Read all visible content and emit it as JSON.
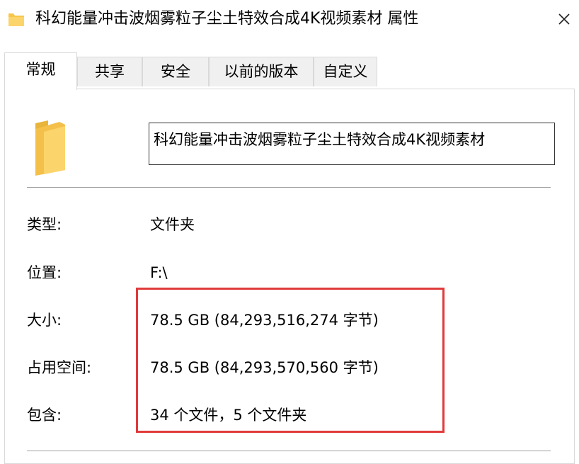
{
  "window": {
    "title": "科幻能量冲击波烟雾粒子尘土特效合成4K视频素材 属性",
    "icon": "folder-icon",
    "close_icon": "close-icon"
  },
  "tabs": [
    {
      "label": "常规",
      "active": true
    },
    {
      "label": "共享",
      "active": false
    },
    {
      "label": "安全",
      "active": false
    },
    {
      "label": "以前的版本",
      "active": false
    },
    {
      "label": "自定义",
      "active": false
    }
  ],
  "general": {
    "folder_name": "科幻能量冲击波烟雾粒子尘土特效合成4K视频素材",
    "properties": [
      {
        "label": "类型:",
        "value": "文件夹"
      },
      {
        "label": "位置:",
        "value": "F:\\"
      },
      {
        "label": "大小:",
        "value": "78.5 GB (84,293,516,274 字节)"
      },
      {
        "label": "占用空间:",
        "value": "78.5 GB (84,293,570,560 字节)"
      },
      {
        "label": "包含:",
        "value": "34 个文件，5 个文件夹"
      }
    ]
  },
  "colors": {
    "folder": "#f7c64b",
    "highlight": "#e03a3a"
  }
}
